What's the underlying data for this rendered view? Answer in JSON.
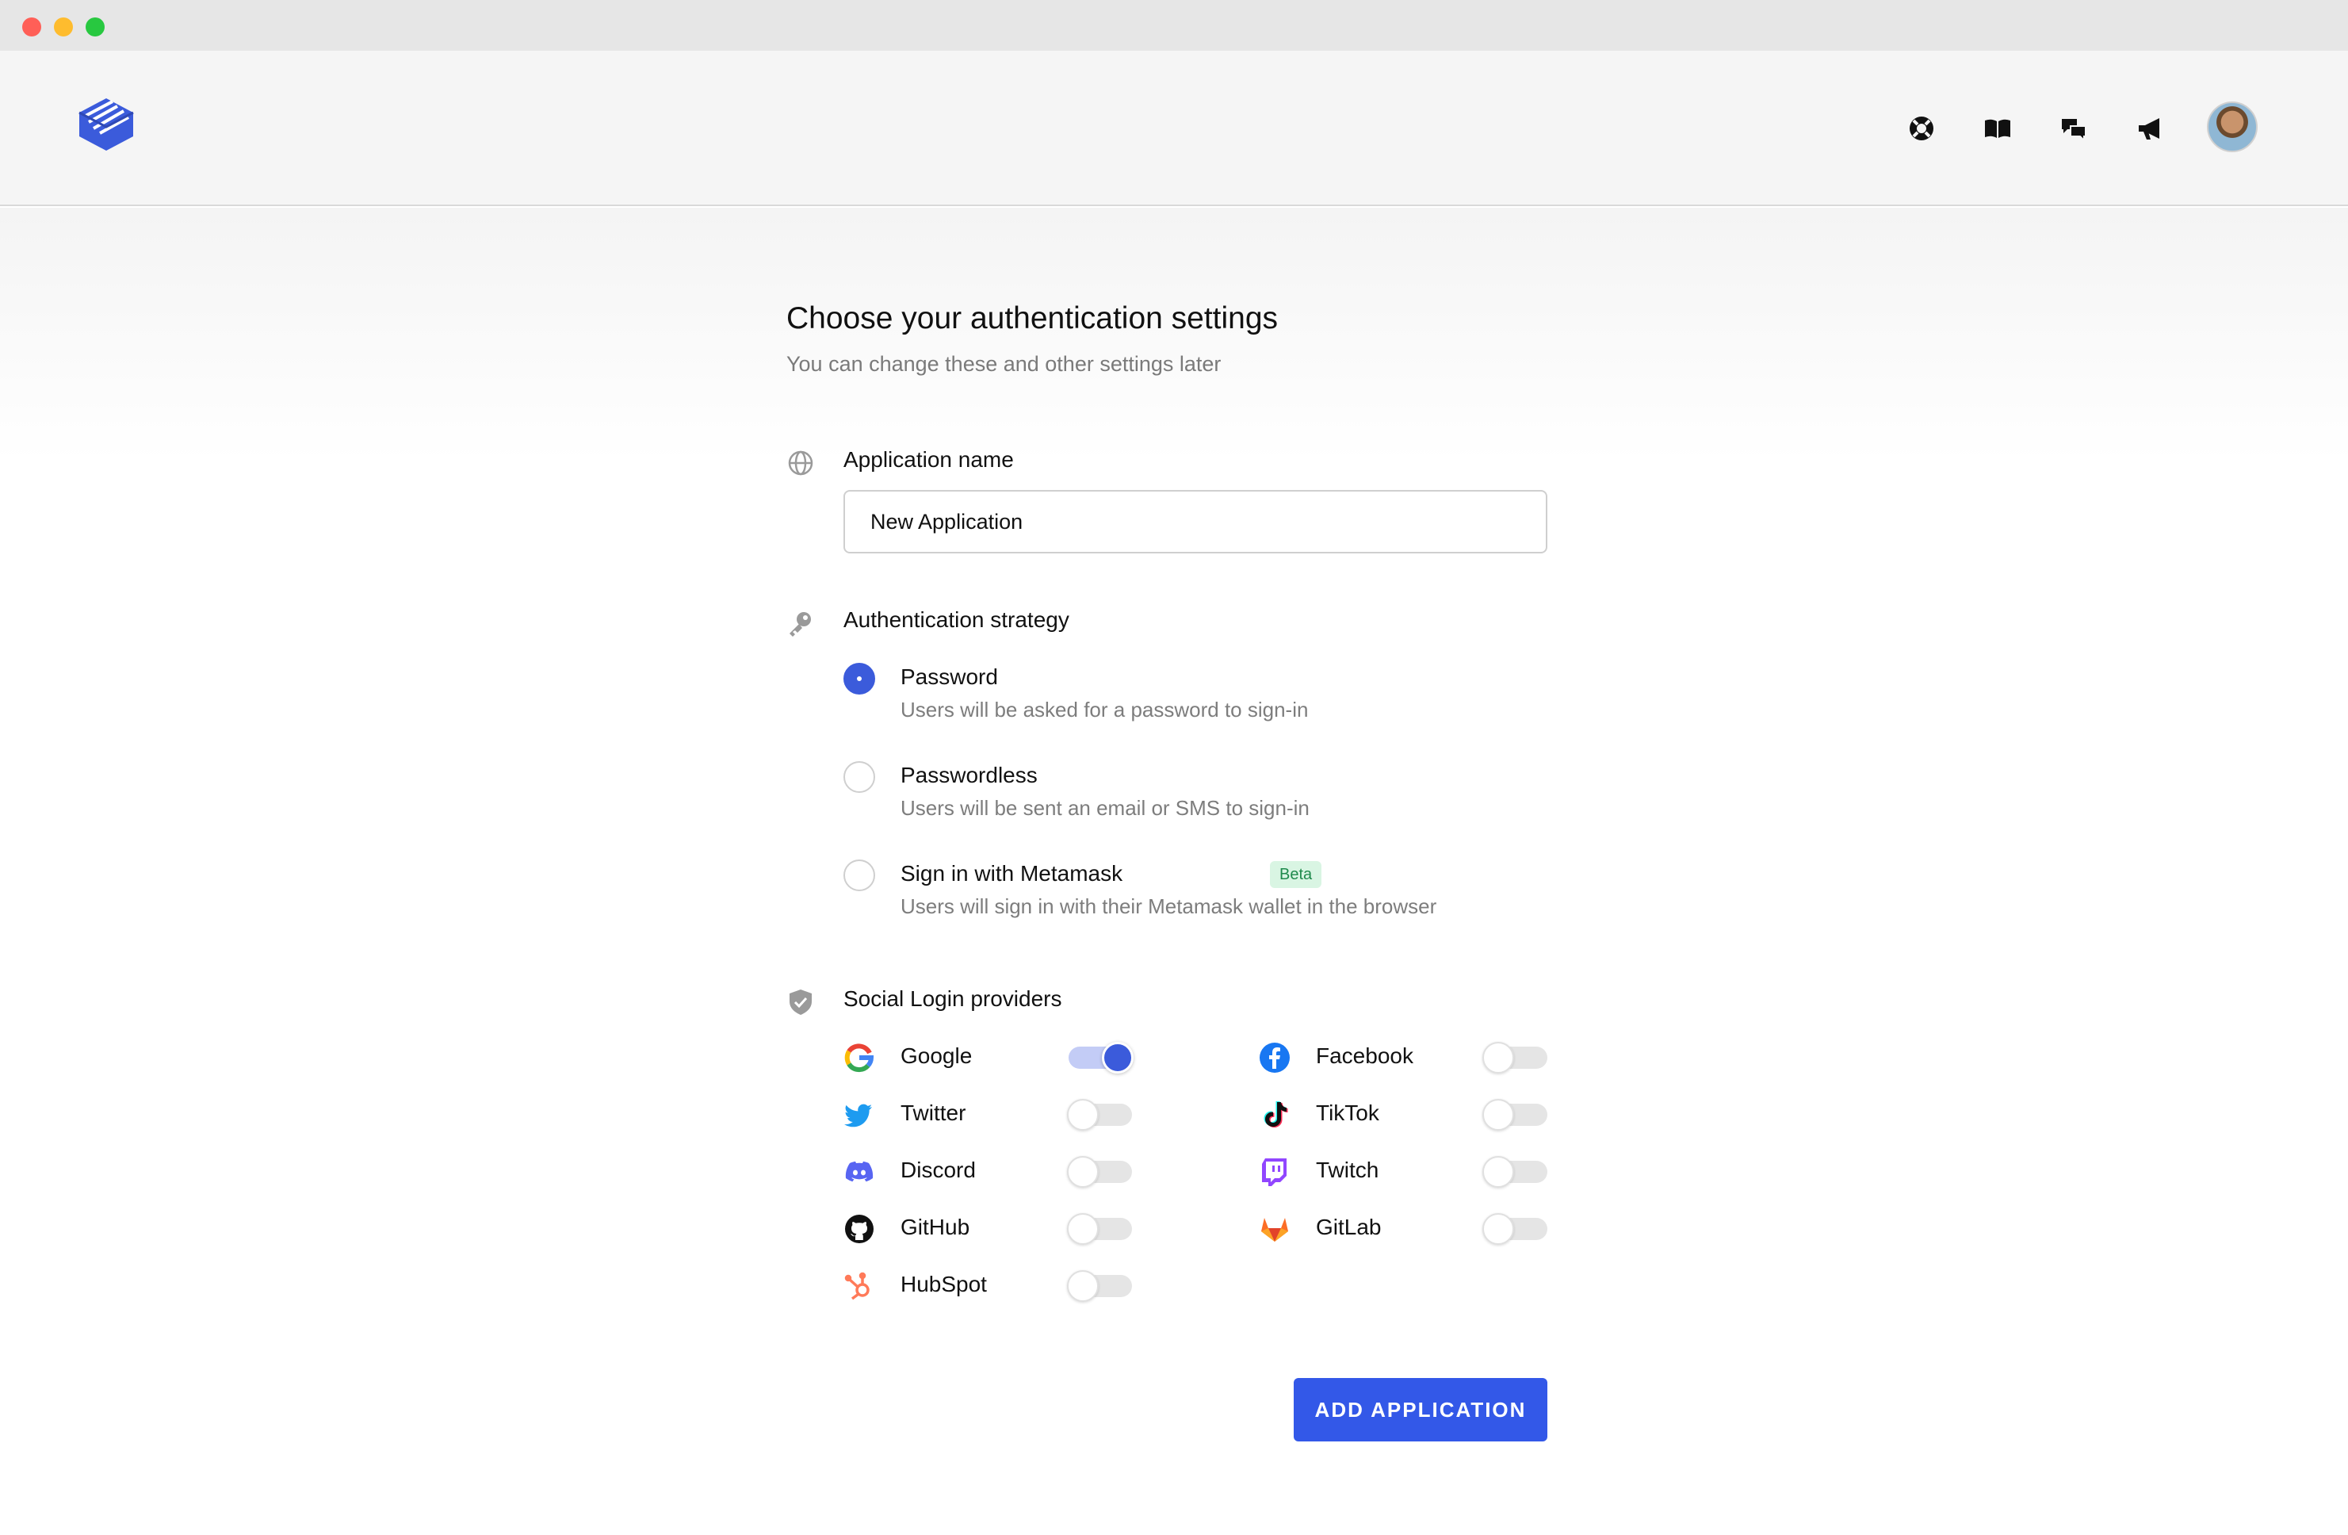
{
  "window": {
    "controls": [
      "close",
      "minimize",
      "maximize"
    ]
  },
  "header": {
    "logo": "app-logo-icon",
    "nav_icons": [
      "lifebuoy-icon",
      "book-icon",
      "chat-icon",
      "megaphone-icon"
    ],
    "avatar": "user-avatar"
  },
  "page": {
    "title": "Choose your authentication settings",
    "subtitle": "You can change these and other settings later"
  },
  "app_name": {
    "label": "Application name",
    "value": "New Application",
    "icon": "globe-icon"
  },
  "strategy": {
    "label": "Authentication strategy",
    "icon": "key-icon",
    "options": [
      {
        "title": "Password",
        "desc": "Users will be asked for a password to sign-in",
        "checked": true
      },
      {
        "title": "Passwordless",
        "desc": "Users will be sent an email or SMS to sign-in",
        "checked": false
      },
      {
        "title": "Sign in with Metamask",
        "desc": "Users will sign in with their Metamask wallet in the browser",
        "checked": false,
        "badge": "Beta"
      }
    ]
  },
  "social": {
    "label": "Social Login providers",
    "icon": "shield-icon",
    "providers": [
      {
        "name": "Google",
        "icon": "google-icon",
        "enabled": true
      },
      {
        "name": "Facebook",
        "icon": "facebook-icon",
        "enabled": false
      },
      {
        "name": "Twitter",
        "icon": "twitter-icon",
        "enabled": false
      },
      {
        "name": "TikTok",
        "icon": "tiktok-icon",
        "enabled": false
      },
      {
        "name": "Discord",
        "icon": "discord-icon",
        "enabled": false
      },
      {
        "name": "Twitch",
        "icon": "twitch-icon",
        "enabled": false
      },
      {
        "name": "GitHub",
        "icon": "github-icon",
        "enabled": false
      },
      {
        "name": "GitLab",
        "icon": "gitlab-icon",
        "enabled": false
      },
      {
        "name": "HubSpot",
        "icon": "hubspot-icon",
        "enabled": false
      }
    ]
  },
  "actions": {
    "add_label": "ADD APPLICATION"
  },
  "colors": {
    "accent": "#3358e8",
    "toggle_on_track": "#c3ccf6",
    "beta_bg": "#d9f5e3",
    "beta_text": "#1f8a4c"
  }
}
